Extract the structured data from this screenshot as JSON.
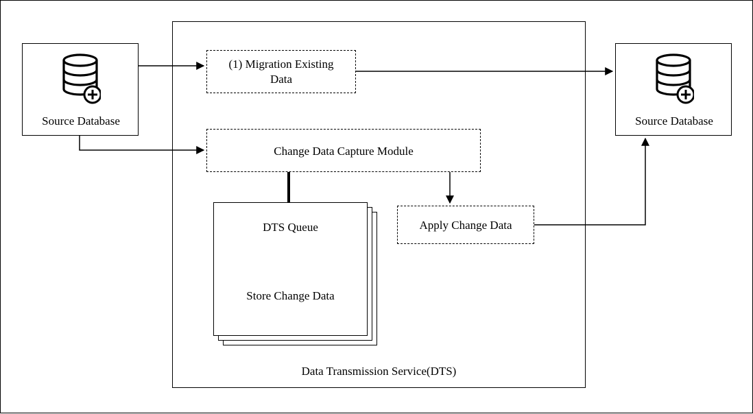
{
  "source_left": {
    "label": "Source Database"
  },
  "source_right": {
    "label": "Source Database"
  },
  "dts_container": {
    "title": "Data Transmission Service(DTS)"
  },
  "migration_box": {
    "label": "(1) Migration Existing\nData"
  },
  "cdc_module": {
    "label": "Change Data Capture Module"
  },
  "dts_queue": {
    "title": "DTS Queue",
    "subtitle": "Store Change Data"
  },
  "apply_box": {
    "label": "Apply Change Data"
  }
}
